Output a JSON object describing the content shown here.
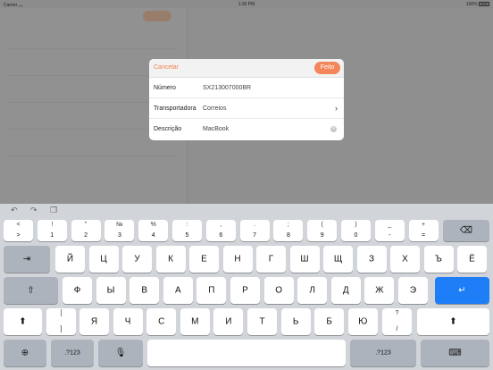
{
  "status": {
    "carrier": "Carrier",
    "time": "1:35 PM",
    "battery": "100%"
  },
  "modal": {
    "cancel": "Cancelar",
    "done": "Feito",
    "rows": [
      {
        "label": "Número",
        "value": "SX213007000BR"
      },
      {
        "label": "Transportadora",
        "value": "Correios"
      },
      {
        "label": "Descrição",
        "value": "MacBook"
      }
    ]
  },
  "keyboard": {
    "numrow": [
      {
        "top": "<",
        "bot": ">"
      },
      {
        "top": "!",
        "bot": "1"
      },
      {
        "top": "\"",
        "bot": "2"
      },
      {
        "top": "№",
        "bot": "3"
      },
      {
        "top": "%",
        "bot": "4"
      },
      {
        "top": ":",
        "bot": "5"
      },
      {
        "top": ",",
        "bot": "6"
      },
      {
        "top": ".",
        "bot": "7"
      },
      {
        "top": ";",
        "bot": "8"
      },
      {
        "top": "(",
        "bot": "9"
      },
      {
        "top": ")",
        "bot": "0"
      },
      {
        "top": "_",
        "bot": "-"
      },
      {
        "top": "+",
        "bot": "="
      }
    ],
    "row1": [
      "Й",
      "Ц",
      "У",
      "К",
      "Е",
      "Н",
      "Г",
      "Ш",
      "Щ",
      "З",
      "Х",
      "Ъ",
      "Ё"
    ],
    "row2": [
      "Ф",
      "Ы",
      "В",
      "А",
      "П",
      "Р",
      "О",
      "Л",
      "Д",
      "Ж",
      "Э"
    ],
    "row3_bracket": {
      "top": "[",
      "bot": "]"
    },
    "row3": [
      "Я",
      "Ч",
      "С",
      "М",
      "И",
      "Т",
      "Ь",
      "Б",
      "Ю"
    ],
    "row3_question": {
      "top": "?",
      "bot": "/"
    },
    "mode_label": ".?123",
    "icons": [
      "undo-icon",
      "redo-icon",
      "paste-icon",
      "delete-icon",
      "tab-icon",
      "shift-icon",
      "return-icon",
      "globe-icon",
      "mic-icon",
      "hide-keyboard-icon"
    ]
  }
}
